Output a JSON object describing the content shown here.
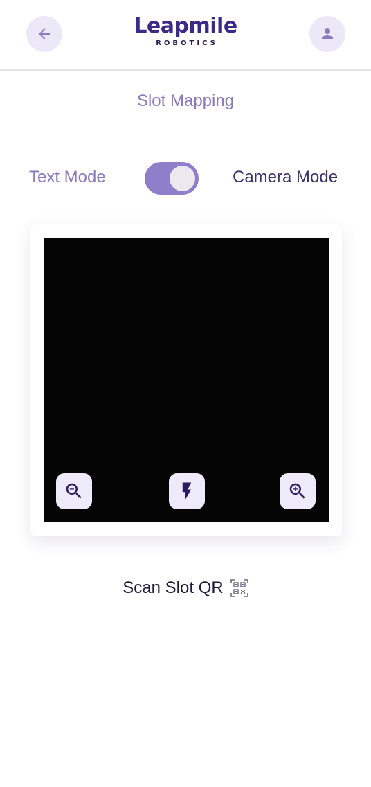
{
  "header": {
    "logo_main": "Leapmile",
    "logo_sub": "ROBOTICS",
    "back_icon": "arrow-left-icon",
    "profile_icon": "person-icon"
  },
  "title": "Slot Mapping",
  "mode_toggle": {
    "left_label": "Text Mode",
    "right_label": "Camera Mode",
    "state": "camera"
  },
  "camera": {
    "controls": [
      "zoom-out-icon",
      "flash-icon",
      "zoom-in-icon"
    ]
  },
  "scan": {
    "label": "Scan Slot QR",
    "icon": "qr-code-icon"
  },
  "colors": {
    "accent": "#8f7fcb",
    "accent_light": "#ece8f7",
    "brand_dark": "#3b2a86",
    "text_primary": "#1e1b3a",
    "text_muted": "#8a7bc0"
  }
}
